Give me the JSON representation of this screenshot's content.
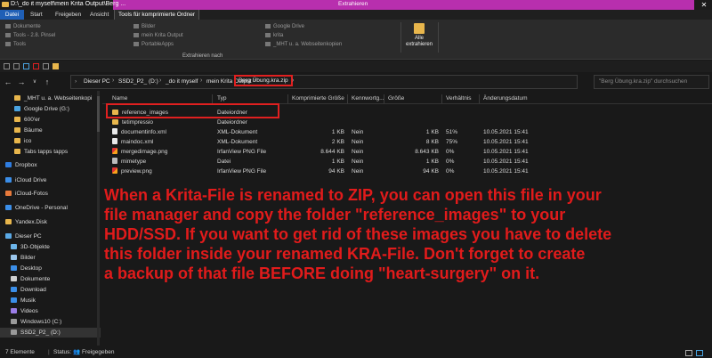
{
  "window": {
    "title": "D:\\_do it myself\\mein Krita Output\\Berg ...",
    "context_label": "Extrahieren",
    "close_glyph": "✕"
  },
  "ribbon": {
    "tabs": [
      "Datei",
      "Start",
      "Freigeben",
      "Ansicht",
      "Tools für komprimierte Ordner"
    ],
    "col1": [
      "Dokumente",
      "Tools - 2.8. Pinsel",
      "Tools"
    ],
    "col2": [
      "Bilder",
      "mein Krita Output",
      "PortableApps"
    ],
    "col3": [
      "Google Drive",
      "krita",
      "_MHT u. a. Webseitenkopien"
    ],
    "extract_caption": "Extrahieren nach",
    "extract_all_line1": "Alle",
    "extract_all_line2": "extrahieren",
    "file_tab_color": "#1f5fb6",
    "context_color": "#b82fae"
  },
  "address": {
    "back": "←",
    "forward": "→",
    "up": "↑",
    "crumbs": [
      "Dieser PC",
      "SSD2_P2_ (D:)",
      "_do it myself",
      "mein Krita Output",
      "Berg Übung.kra.zip"
    ],
    "search_placeholder": "\"Berg Übung.kra.zip\" durchsuchen"
  },
  "nav": {
    "items": [
      {
        "label": "_MHT u. a. Webseitenkopi",
        "icon": "folder-icon",
        "color": "#e8b64c"
      },
      {
        "label": "Google Drive (G:)",
        "icon": "drive-icon",
        "color": "#4aa3df"
      },
      {
        "label": "600'er",
        "icon": "folder-icon",
        "color": "#e8b64c"
      },
      {
        "label": "Bäume",
        "icon": "folder-icon",
        "color": "#e8b64c"
      },
      {
        "label": "ico",
        "icon": "folder-icon",
        "color": "#e8b64c"
      },
      {
        "label": "Tabs tapps tapps",
        "icon": "folder-icon",
        "color": "#e8b64c"
      },
      {
        "label": "Dropbox",
        "icon": "dropbox-icon",
        "color": "#2f7de1"
      },
      {
        "label": "iCloud Drive",
        "icon": "cloud-icon",
        "color": "#3b8ee8"
      },
      {
        "label": "iCloud-Fotos",
        "icon": "photos-icon",
        "color": "#e87a3b"
      },
      {
        "label": "OneDrive - Personal",
        "icon": "onedrive-icon",
        "color": "#3b8ee8"
      },
      {
        "label": "Yandex.Disk",
        "icon": "yandex-icon",
        "color": "#e8b64c"
      },
      {
        "label": "Dieser PC",
        "icon": "pc-icon",
        "color": "#5aa9e6"
      },
      {
        "label": "3D-Objekte",
        "icon": "cube-icon",
        "color": "#6cb5ea"
      },
      {
        "label": "Bilder",
        "icon": "pictures-icon",
        "color": "#9ac6ec"
      },
      {
        "label": "Desktop",
        "icon": "desktop-icon",
        "color": "#3b8ee8"
      },
      {
        "label": "Dokumente",
        "icon": "documents-icon",
        "color": "#cfcfcf"
      },
      {
        "label": "Download",
        "icon": "download-icon",
        "color": "#3b8ee8"
      },
      {
        "label": "Musik",
        "icon": "music-icon",
        "color": "#3b8ee8"
      },
      {
        "label": "Videos",
        "icon": "videos-icon",
        "color": "#9b7de6"
      },
      {
        "label": "Windows10 (C:)",
        "icon": "disk-icon",
        "color": "#9a9a9a"
      },
      {
        "label": "SSD2_P2_ (D:)",
        "icon": "disk-icon",
        "color": "#9a9a9a"
      }
    ]
  },
  "columns": [
    "Name",
    "Typ",
    "Komprimierte Größe",
    "Kennwortg...",
    "Größe",
    "Verhältnis",
    "Änderungsdatum"
  ],
  "files": [
    {
      "name": "reference_images",
      "type": "Dateiordner",
      "csize": "",
      "pw": "",
      "size": "",
      "ratio": "",
      "date": "",
      "icon": "folder-icon",
      "kind": "folder"
    },
    {
      "name": "tetimpressio",
      "type": "Dateiordner",
      "csize": "",
      "pw": "",
      "size": "",
      "ratio": "",
      "date": "",
      "icon": "folder-icon",
      "kind": "folder"
    },
    {
      "name": "documentinfo.xml",
      "type": "XML-Dokument",
      "csize": "1 KB",
      "pw": "Nein",
      "size": "1 KB",
      "ratio": "51%",
      "date": "10.05.2021 15:41",
      "icon": "xml-file-icon",
      "kind": "doc"
    },
    {
      "name": "maindoc.xml",
      "type": "XML-Dokument",
      "csize": "2 KB",
      "pw": "Nein",
      "size": "8 KB",
      "ratio": "75%",
      "date": "10.05.2021 15:41",
      "icon": "xml-file-icon",
      "kind": "doc"
    },
    {
      "name": "mergedimage.png",
      "type": "IrfanView PNG File",
      "csize": "8.644 KB",
      "pw": "Nein",
      "size": "8.643 KB",
      "ratio": "0%",
      "date": "10.05.2021 15:41",
      "icon": "png-file-icon",
      "kind": "img"
    },
    {
      "name": "mimetype",
      "type": "Datei",
      "csize": "1 KB",
      "pw": "Nein",
      "size": "1 KB",
      "ratio": "0%",
      "date": "10.05.2021 15:41",
      "icon": "file-icon",
      "kind": "file"
    },
    {
      "name": "preview.png",
      "type": "IrfanView PNG File",
      "csize": "94 KB",
      "pw": "Nein",
      "size": "94 KB",
      "ratio": "0%",
      "date": "10.05.2021 15:41",
      "icon": "png-file-icon",
      "kind": "img"
    }
  ],
  "annotation": {
    "lines": [
      "When a Krita-File is renamed to ZIP, you can open this file in your",
      "file manager and copy the folder \"reference_images\" to your",
      "HDD/SSD. If you want to get rid of these images you have to delete",
      "this folder inside your renamed KRA-File. Don't forget to create",
      "a backup of that file BEFORE doing \"heart-surgery\" on it."
    ],
    "color": "#e11b1b"
  },
  "status": {
    "count": "7 Elemente",
    "share": "Status: 👥 Freigegeben"
  }
}
